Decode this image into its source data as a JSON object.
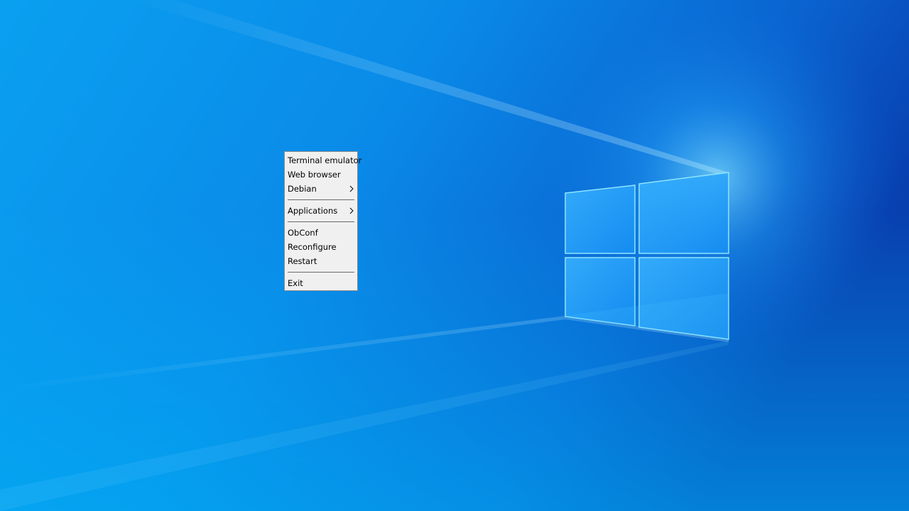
{
  "desktop": {
    "wallpaper": "windows-10-hero-wallpaper",
    "colors": {
      "sky_dark": "#0a4fc0",
      "sky_mid": "#0a78df",
      "sky_light": "#0aa8f0",
      "logo_pane": "#2aa6ff",
      "logo_edge": "#7fe0ff"
    }
  },
  "root_menu": {
    "items": [
      {
        "label": "Terminal emulator"
      },
      {
        "label": "Web browser"
      },
      {
        "label": "Debian",
        "submenu_icon": "chevron-right-icon"
      },
      {
        "label": "Applications",
        "submenu_icon": "chevron-right-icon"
      },
      {
        "label": "ObConf"
      },
      {
        "label": "Reconfigure"
      },
      {
        "label": "Restart"
      },
      {
        "label": "Exit"
      }
    ],
    "colors": {
      "background": "#f0f0f0",
      "border": "#8c8c8c",
      "separator": "#6a6a6a",
      "text": "#000000"
    }
  }
}
